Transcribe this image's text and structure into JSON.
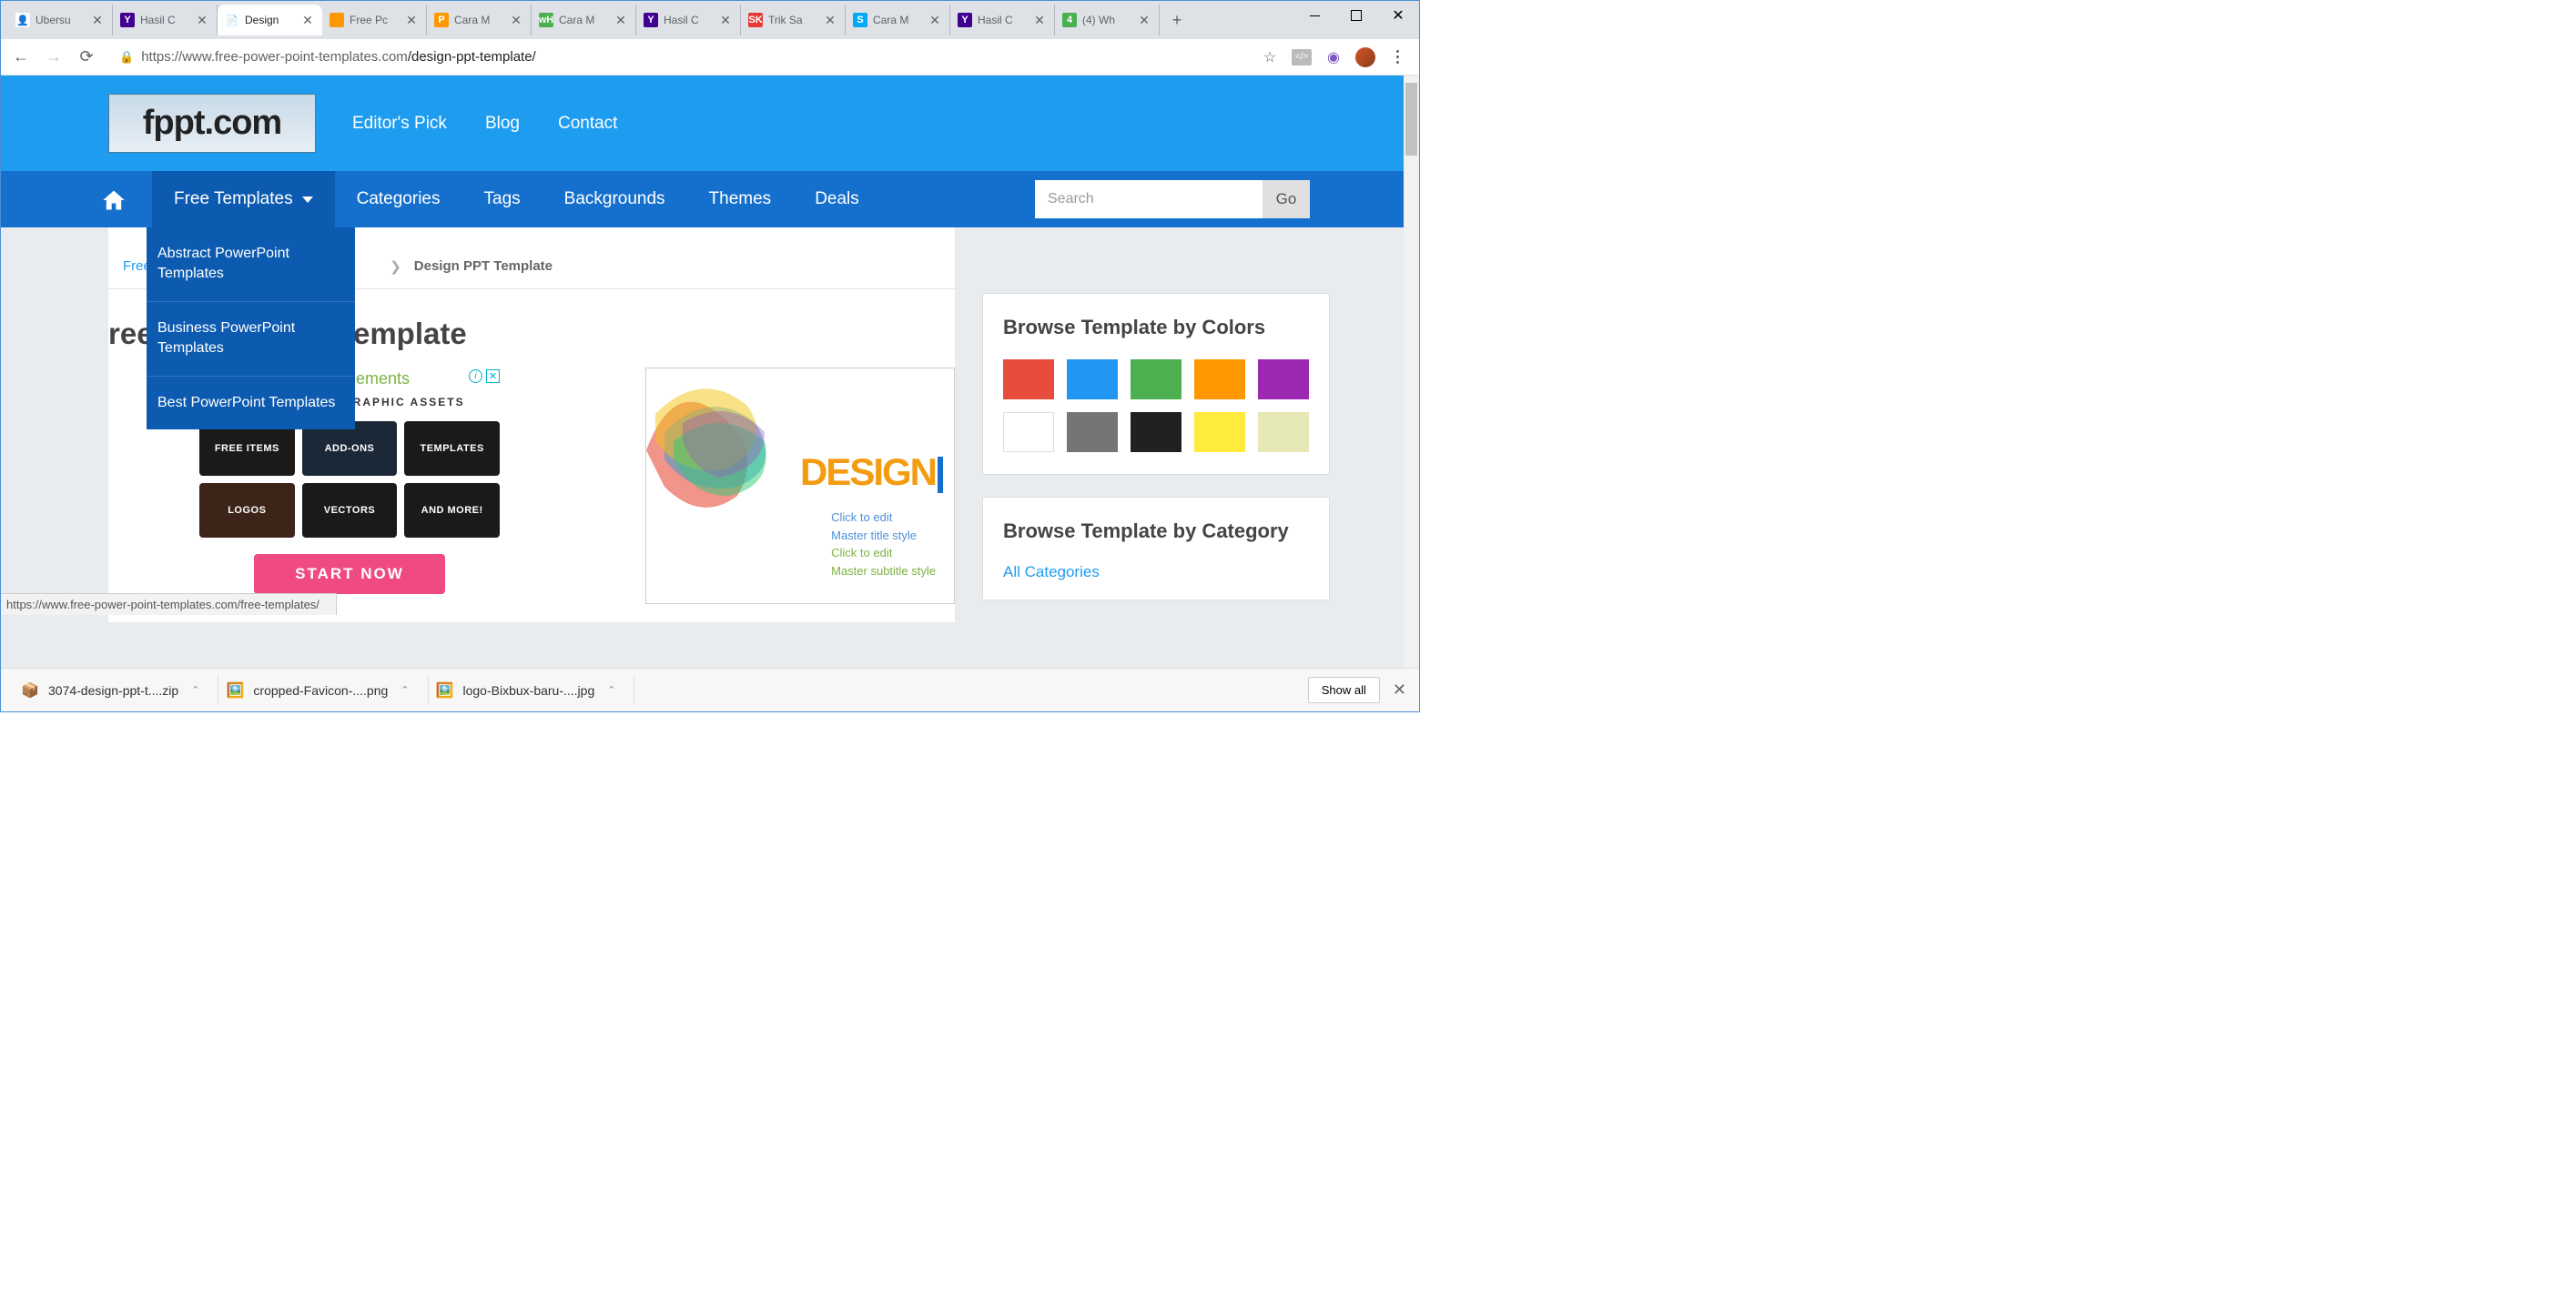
{
  "tabs": [
    {
      "title": "Ubersu",
      "favicon_bg": "#fff",
      "favicon_text": "👤"
    },
    {
      "title": "Hasil C",
      "favicon_bg": "#400090",
      "favicon_text": "Y"
    },
    {
      "title": "Design",
      "favicon_bg": "#fff",
      "favicon_text": "📄",
      "active": true
    },
    {
      "title": "Free Pc",
      "favicon_bg": "#ff9800",
      "favicon_text": ""
    },
    {
      "title": "Cara M",
      "favicon_bg": "#ff9800",
      "favicon_text": "P"
    },
    {
      "title": "Cara M",
      "favicon_bg": "#4caf50",
      "favicon_text": "wH"
    },
    {
      "title": "Hasil C",
      "favicon_bg": "#400090",
      "favicon_text": "Y"
    },
    {
      "title": "Trik Sa",
      "favicon_bg": "#e53935",
      "favicon_text": "SK"
    },
    {
      "title": "Cara M",
      "favicon_bg": "#03a9f4",
      "favicon_text": "S"
    },
    {
      "title": "Hasil C",
      "favicon_bg": "#400090",
      "favicon_text": "Y"
    },
    {
      "title": "(4) Wh",
      "favicon_bg": "#4caf50",
      "favicon_text": "4"
    }
  ],
  "url": {
    "host": "https://www.free-power-point-templates.com",
    "path": "/design-ppt-template/"
  },
  "logo": "fppt.com",
  "top_links": [
    "Editor's Pick",
    "Blog",
    "Contact"
  ],
  "nav": {
    "free": "Free Templates",
    "categories": "Categories",
    "tags": "Tags",
    "backgrounds": "Backgrounds",
    "themes": "Themes",
    "deals": "Deals"
  },
  "search": {
    "placeholder": "Search",
    "go": "Go"
  },
  "dropdown": [
    "Abstract PowerPoint Templates",
    "Business PowerPoint Templates",
    "Best PowerPoint Templates"
  ],
  "breadcrumb": {
    "home": "Free I",
    "current": "Design PPT Template"
  },
  "title": "ree Design PPT Template",
  "ad": {
    "brand": "envato elements",
    "sub": "READY TO USE GRAPHIC ASSETS",
    "tiles": [
      "FREE ITEMS",
      "ADD-ONS",
      "TEMPLATES",
      "LOGOS",
      "VECTORS",
      "AND MORE!"
    ],
    "cta": "START NOW"
  },
  "preview": {
    "design": "DESIGN",
    "l1": "Click to edit",
    "l2": "Master title style",
    "l3": "Click to edit",
    "l4": "Master subtitle style"
  },
  "sidebar": {
    "colors_title": "Browse Template by Colors",
    "colors": [
      "#e74c3c",
      "#2196f3",
      "#4caf50",
      "#ff9800",
      "#9c27b0",
      "#ffffff",
      "#757575",
      "#212121",
      "#ffeb3b",
      "#e6e8b5"
    ],
    "cat_title": "Browse Template by Category",
    "cat_link": "All Categories"
  },
  "status": "https://www.free-power-point-templates.com/free-templates/",
  "downloads": {
    "items": [
      "3074-design-ppt-t....zip",
      "cropped-Favicon-....png",
      "logo-Bixbux-baru-....jpg"
    ],
    "show_all": "Show all"
  }
}
